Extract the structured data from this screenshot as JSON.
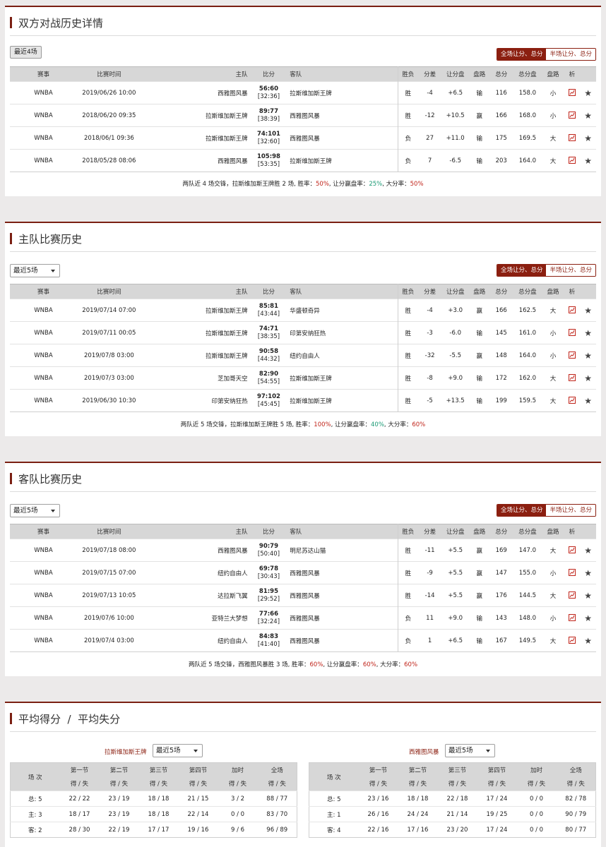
{
  "h2h": {
    "title": "双方对战历史详情",
    "recent_label": "最近4场",
    "toggle": [
      "全场让分、总分",
      "半场让分、总分"
    ],
    "headers": [
      "赛事",
      "比赛时间",
      "主队",
      "比分",
      "客队",
      "胜负",
      "分差",
      "让分盘",
      "盘路",
      "总分",
      "总分盘",
      "盘路",
      "析"
    ],
    "rows": [
      {
        "league": "WNBA",
        "time": "2019/06/26 10:00",
        "home": "西雅图风暴",
        "score": "56:60",
        "half": "[32:36]",
        "away": "拉斯维加斯王牌",
        "wl": "胜",
        "diff": "-4",
        "line": "+6.5",
        "pan": "输",
        "total": "116",
        "ou": "158.0",
        "ou_res": "小",
        "home_color": "normal",
        "away_color": "red"
      },
      {
        "league": "WNBA",
        "time": "2018/06/20 09:35",
        "home": "拉斯维加斯王牌",
        "score": "89:77",
        "half": "[38:39]",
        "away": "西雅图风暴",
        "wl": "胜",
        "diff": "-12",
        "line": "+10.5",
        "pan": "赢",
        "total": "166",
        "ou": "168.0",
        "ou_res": "小",
        "home_color": "red",
        "away_color": "normal"
      },
      {
        "league": "WNBA",
        "time": "2018/06/1 09:36",
        "home": "拉斯维加斯王牌",
        "score": "74:101",
        "half": "[32:60]",
        "away": "西雅图风暴",
        "wl": "负",
        "diff": "27",
        "line": "+11.0",
        "pan": "输",
        "total": "175",
        "ou": "169.5",
        "ou_res": "大",
        "home_color": "red",
        "away_color": "normal"
      },
      {
        "league": "WNBA",
        "time": "2018/05/28 08:06",
        "home": "西雅图风暴",
        "score": "105:98",
        "half": "[53:35]",
        "away": "拉斯维加斯王牌",
        "wl": "负",
        "diff": "7",
        "line": "-6.5",
        "pan": "输",
        "total": "203",
        "ou": "164.0",
        "ou_res": "大",
        "home_color": "normal",
        "away_color": "red"
      }
    ],
    "summary": {
      "pre": "两队近 4 场交锋，拉斯维加斯王牌胜 2 场, 胜率：",
      "win": "50%",
      "mid": ", 让分赢盘率：",
      "cover": "25%",
      "mid2": ", 大分率：",
      "over": "50%"
    }
  },
  "home_hist": {
    "title": "主队比赛历史",
    "select": "最近5场",
    "toggle": [
      "全场让分、总分",
      "半场让分、总分"
    ],
    "headers": [
      "赛事",
      "比赛时间",
      "主队",
      "比分",
      "客队",
      "胜负",
      "分差",
      "让分盘",
      "盘路",
      "总分",
      "总分盘",
      "盘路",
      "析"
    ],
    "rows": [
      {
        "league": "WNBA",
        "time": "2019/07/14 07:00",
        "home": "拉斯维加斯王牌",
        "score": "85:81",
        "half": "[43:44]",
        "away": "华盛顿奇异",
        "wl": "胜",
        "diff": "-4",
        "line": "+3.0",
        "pan": "赢",
        "total": "166",
        "ou": "162.5",
        "ou_res": "大",
        "home_color": "red",
        "away_color": "normal"
      },
      {
        "league": "WNBA",
        "time": "2019/07/11 00:05",
        "home": "拉斯维加斯王牌",
        "score": "74:71",
        "half": "[38:35]",
        "away": "印第安纳狂热",
        "wl": "胜",
        "diff": "-3",
        "line": "-6.0",
        "pan": "输",
        "total": "145",
        "ou": "161.0",
        "ou_res": "小",
        "home_color": "red",
        "away_color": "normal"
      },
      {
        "league": "WNBA",
        "time": "2019/07/8 03:00",
        "home": "拉斯维加斯王牌",
        "score": "90:58",
        "half": "[44:32]",
        "away": "纽约自由人",
        "wl": "胜",
        "diff": "-32",
        "line": "-5.5",
        "pan": "赢",
        "total": "148",
        "ou": "164.0",
        "ou_res": "小",
        "home_color": "red",
        "away_color": "normal"
      },
      {
        "league": "WNBA",
        "time": "2019/07/3 03:00",
        "home": "芝加哥天空",
        "score": "82:90",
        "half": "[54:55]",
        "away": "拉斯维加斯王牌",
        "wl": "胜",
        "diff": "-8",
        "line": "+9.0",
        "pan": "输",
        "total": "172",
        "ou": "162.0",
        "ou_res": "大",
        "home_color": "normal",
        "away_color": "red"
      },
      {
        "league": "WNBA",
        "time": "2019/06/30 10:30",
        "home": "印第安纳狂热",
        "score": "97:102",
        "half": "[45:45]",
        "away": "拉斯维加斯王牌",
        "wl": "胜",
        "diff": "-5",
        "line": "+13.5",
        "pan": "输",
        "total": "199",
        "ou": "159.5",
        "ou_res": "大",
        "home_color": "normal",
        "away_color": "red"
      }
    ],
    "summary": {
      "pre": "两队近 5 场交锋，拉斯维加斯王牌胜 5 场, 胜率：",
      "win": "100%",
      "mid": ", 让分赢盘率：",
      "cover": "40%",
      "mid2": ", 大分率：",
      "over": "60%"
    }
  },
  "away_hist": {
    "title": "客队比赛历史",
    "select": "最近5场",
    "toggle": [
      "全场让分、总分",
      "半场让分、总分"
    ],
    "headers": [
      "赛事",
      "比赛时间",
      "主队",
      "比分",
      "客队",
      "胜负",
      "分差",
      "让分盘",
      "盘路",
      "总分",
      "总分盘",
      "盘路",
      "析"
    ],
    "rows": [
      {
        "league": "WNBA",
        "time": "2019/07/18 08:00",
        "home": "西雅图风暴",
        "score": "90:79",
        "half": "[50:40]",
        "away": "明尼苏达山猫",
        "wl": "胜",
        "diff": "-11",
        "line": "+5.5",
        "pan": "赢",
        "total": "169",
        "ou": "147.0",
        "ou_res": "大",
        "home_color": "blue",
        "away_color": "normal"
      },
      {
        "league": "WNBA",
        "time": "2019/07/15 07:00",
        "home": "纽约自由人",
        "score": "69:78",
        "half": "[30:43]",
        "away": "西雅图风暴",
        "wl": "胜",
        "diff": "-9",
        "line": "+5.5",
        "pan": "赢",
        "total": "147",
        "ou": "155.0",
        "ou_res": "小",
        "home_color": "normal",
        "away_color": "blue"
      },
      {
        "league": "WNBA",
        "time": "2019/07/13 10:05",
        "home": "达拉斯飞翼",
        "score": "81:95",
        "half": "[29:52]",
        "away": "西雅图风暴",
        "wl": "胜",
        "diff": "-14",
        "line": "+5.5",
        "pan": "赢",
        "total": "176",
        "ou": "144.5",
        "ou_res": "大",
        "home_color": "normal",
        "away_color": "blue"
      },
      {
        "league": "WNBA",
        "time": "2019/07/6 10:00",
        "home": "亚特兰大梦想",
        "score": "77:66",
        "half": "[32:24]",
        "away": "西雅图风暴",
        "wl": "负",
        "diff": "11",
        "line": "+9.0",
        "pan": "输",
        "total": "143",
        "ou": "148.0",
        "ou_res": "小",
        "home_color": "normal",
        "away_color": "blue"
      },
      {
        "league": "WNBA",
        "time": "2019/07/4 03:00",
        "home": "纽约自由人",
        "score": "84:83",
        "half": "[41:40]",
        "away": "西雅图风暴",
        "wl": "负",
        "diff": "1",
        "line": "+6.5",
        "pan": "输",
        "total": "167",
        "ou": "149.5",
        "ou_res": "大",
        "home_color": "normal",
        "away_color": "blue"
      }
    ],
    "summary": {
      "pre": "两队近 5 场交锋，西雅图风暴胜 3 场, 胜率：",
      "win": "60%",
      "mid": ", 让分赢盘率：",
      "cover": "60%",
      "mid2": ", 大分率：",
      "over": "60%"
    }
  },
  "avg": {
    "title": "平均得分  /  平均失分",
    "left": {
      "team": "拉斯维加斯王牌",
      "select": "最近5场",
      "head1": [
        "场 次",
        "第一节",
        "第二节",
        "第三节",
        "第四节",
        "加时",
        "全场"
      ],
      "head2": [
        "得 / 失",
        "得 / 失",
        "得 / 失",
        "得 / 失",
        "得 / 失",
        "得 / 失"
      ],
      "rows": [
        [
          "总: 5",
          "22 / 22",
          "23 / 19",
          "18 / 18",
          "21 / 15",
          "3 / 2",
          "88 / 77"
        ],
        [
          "主: 3",
          "18 / 17",
          "23 / 19",
          "18 / 18",
          "22 / 14",
          "0 / 0",
          "83 / 70"
        ],
        [
          "客: 2",
          "28 / 30",
          "22 / 19",
          "17 / 17",
          "19 / 16",
          "9 / 6",
          "96 / 89"
        ]
      ]
    },
    "right": {
      "team": "西雅图风暴",
      "select": "最近5场",
      "head1": [
        "场 次",
        "第一节",
        "第二节",
        "第三节",
        "第四节",
        "加时",
        "全场"
      ],
      "head2": [
        "得 / 失",
        "得 / 失",
        "得 / 失",
        "得 / 失",
        "得 / 失",
        "得 / 失"
      ],
      "rows": [
        [
          "总: 5",
          "23 / 16",
          "18 / 18",
          "22 / 18",
          "17 / 24",
          "0 / 0",
          "82 / 78"
        ],
        [
          "主: 1",
          "26 / 16",
          "24 / 24",
          "21 / 14",
          "19 / 25",
          "0 / 0",
          "90 / 79"
        ],
        [
          "客: 4",
          "22 / 16",
          "17 / 16",
          "23 / 20",
          "17 / 24",
          "0 / 0",
          "80 / 77"
        ]
      ]
    }
  },
  "colors": {
    "accent": "#8b1f10",
    "win": "#c0241a",
    "lose": "#1a9a74",
    "team_blue": "#1d6fb8"
  },
  "icons": {
    "analysis": "chart-line-icon",
    "favorite": "star-icon",
    "dropdown": "caret-down-icon"
  }
}
